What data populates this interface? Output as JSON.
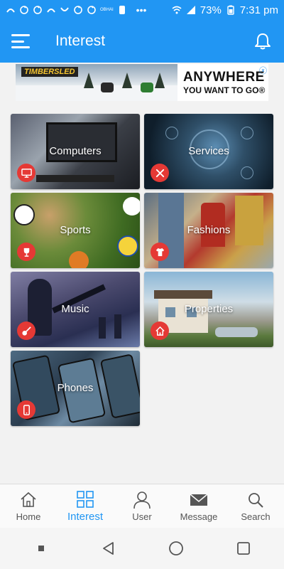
{
  "status_bar": {
    "battery": "73%",
    "time": "7:31 pm",
    "carrier_tag": "OBHAI",
    "more": "•••"
  },
  "app_bar": {
    "title": "Interest"
  },
  "ad": {
    "brand": "TIMBERSLED",
    "headline": "ANYWHERE",
    "subline": "YOU WANT TO GO®",
    "close": "ⓧ"
  },
  "categories": [
    {
      "label": "Computers",
      "icon": "monitor-icon"
    },
    {
      "label": "Services",
      "icon": "tools-icon"
    },
    {
      "label": "Sports",
      "icon": "trophy-icon"
    },
    {
      "label": "Fashions",
      "icon": "tshirt-icon"
    },
    {
      "label": "Music",
      "icon": "guitar-icon"
    },
    {
      "label": "Properties",
      "icon": "house-icon"
    },
    {
      "label": "Phones",
      "icon": "phone-icon"
    }
  ],
  "bottom_nav": {
    "items": [
      {
        "label": "Home",
        "icon": "home-icon",
        "active": false
      },
      {
        "label": "Interest",
        "icon": "grid-icon",
        "active": true
      },
      {
        "label": "User",
        "icon": "user-icon",
        "active": false
      },
      {
        "label": "Message",
        "icon": "mail-icon",
        "active": false
      },
      {
        "label": "Search",
        "icon": "search-icon",
        "active": false
      }
    ]
  },
  "colors": {
    "primary": "#2196f3",
    "badge": "#e53935",
    "background": "#f2f2f2"
  }
}
